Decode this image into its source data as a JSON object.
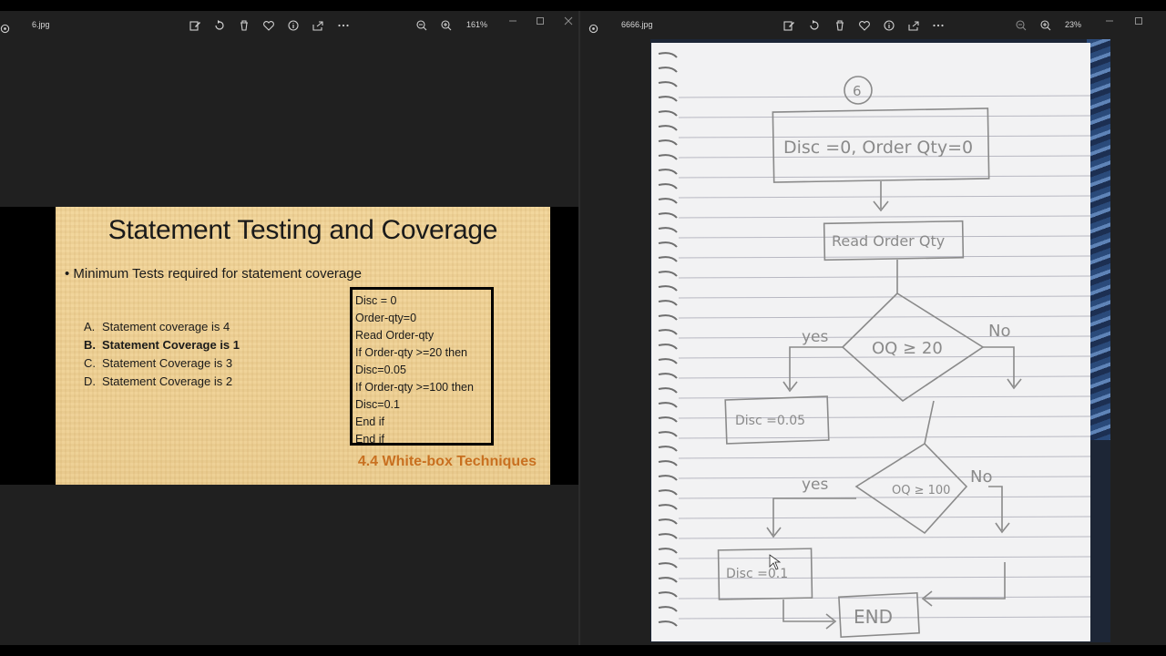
{
  "left_window": {
    "filename": "6.jpg",
    "zoom": "161%",
    "slide": {
      "title": "Statement Testing and Coverage",
      "bullet": "• Minimum Tests required for statement coverage",
      "options": [
        {
          "letter": "A.",
          "text": "Statement coverage is 4"
        },
        {
          "letter": "B.",
          "text": "Statement Coverage is 1"
        },
        {
          "letter": "C.",
          "text": "Statement Coverage is 3"
        },
        {
          "letter": "D.",
          "text": "Statement Coverage is 2"
        }
      ],
      "code_lines": [
        "Disc = 0",
        "Order-qty=0",
        "Read Order-qty",
        "If Order-qty >=20 then",
        "Disc=0.05",
        "If Order-qty >=100 then",
        "Disc=0.1",
        "End if",
        "End if"
      ],
      "footer": "4.4 White-box Techniques"
    }
  },
  "right_window": {
    "filename": "6666.jpg",
    "zoom": "23%",
    "sketch": {
      "page_number": "6",
      "init_box": "Disc =0, Order Qty=0",
      "read_box": "Read Order Qty",
      "decision1": "OQ ≥ 20",
      "decision2": "OQ ≥ 100",
      "yes_label": "yes",
      "no_label": "No",
      "disc1": "Disc =0.05",
      "disc2": "Disc =0.1",
      "end": "END"
    }
  },
  "toolbar_icons": [
    "edit-icon",
    "rotate-icon",
    "delete-icon",
    "favorite-icon",
    "info-icon",
    "share-icon",
    "more-icon"
  ],
  "colors": {
    "window_bg": "#202020",
    "slide_bg": "#efd196",
    "footer_orange": "#c87020",
    "paper": "#f2f2f3",
    "pencil": "#8a8a8a"
  }
}
